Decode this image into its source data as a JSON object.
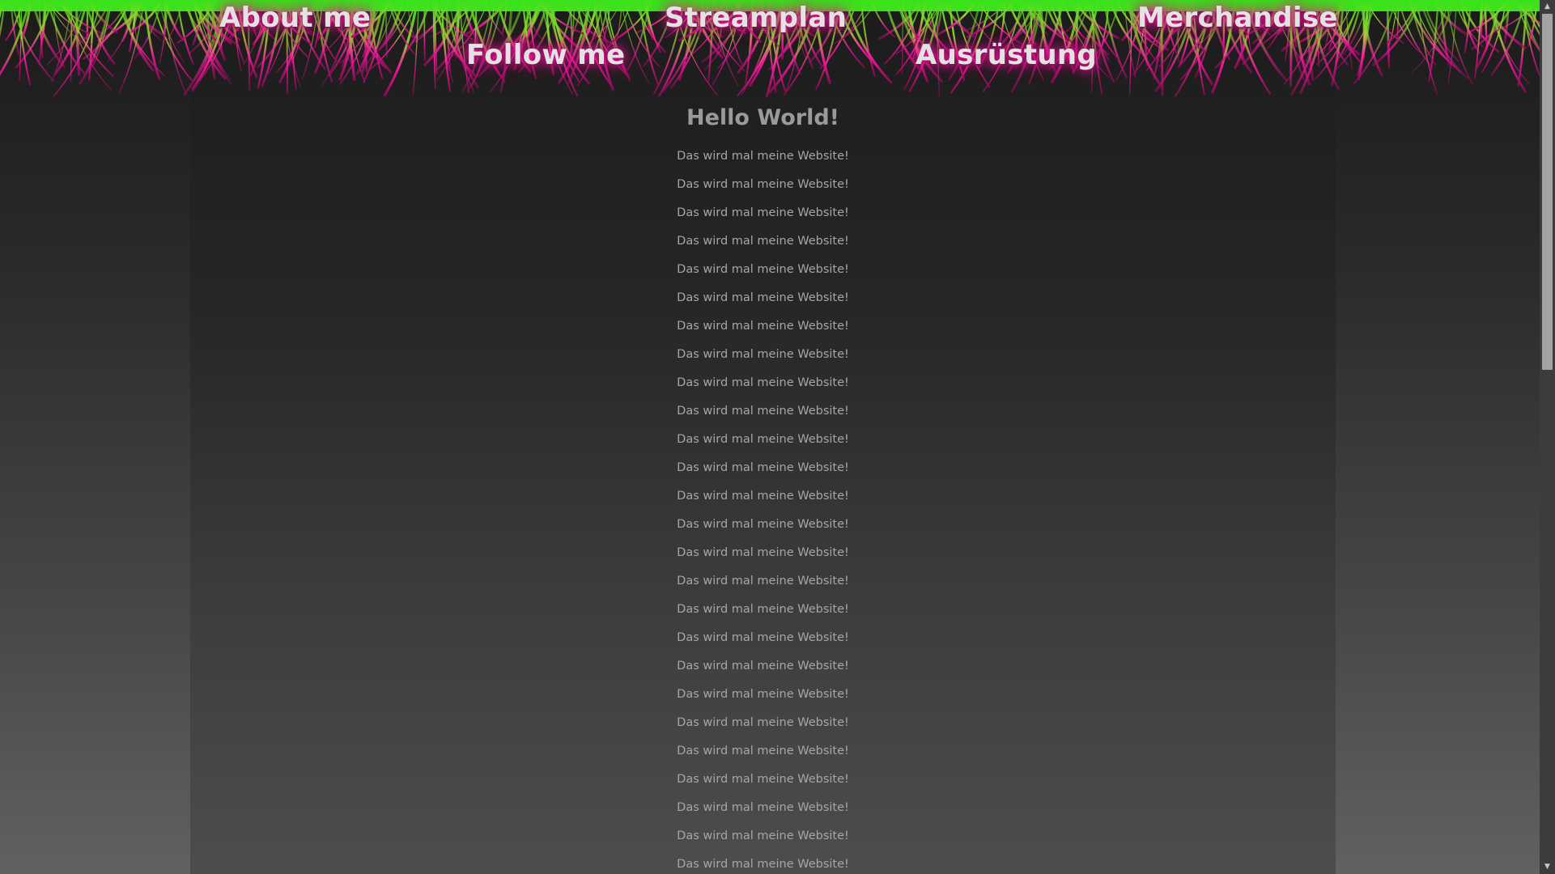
{
  "nav": {
    "about": "About me",
    "streamplan": "Streamplan",
    "merchandise": "Merchandise",
    "follow": "Follow me",
    "ausruestung": "Ausrüstung"
  },
  "main": {
    "heading": "Hello World!",
    "lines": [
      "Das wird mal meine Website!",
      "Das wird mal meine Website!",
      "Das wird mal meine Website!",
      "Das wird mal meine Website!",
      "Das wird mal meine Website!",
      "Das wird mal meine Website!",
      "Das wird mal meine Website!",
      "Das wird mal meine Website!",
      "Das wird mal meine Website!",
      "Das wird mal meine Website!",
      "Das wird mal meine Website!",
      "Das wird mal meine Website!",
      "Das wird mal meine Website!",
      "Das wird mal meine Website!",
      "Das wird mal meine Website!",
      "Das wird mal meine Website!",
      "Das wird mal meine Website!",
      "Das wird mal meine Website!",
      "Das wird mal meine Website!",
      "Das wird mal meine Website!",
      "Das wird mal meine Website!",
      "Das wird mal meine Website!",
      "Das wird mal meine Website!",
      "Das wird mal meine Website!",
      "Das wird mal meine Website!",
      "Das wird mal meine Website!"
    ]
  },
  "colors": {
    "grass_green": "#39e21a",
    "grass_pink": "#ff1aa3",
    "nav_text": "#e3e3e3",
    "heading_text": "#9a9a9a",
    "body_text": "#a6a6a6"
  },
  "scrollbar": {
    "up_icon": "arrow-up-icon",
    "down_icon": "arrow-down-icon"
  }
}
